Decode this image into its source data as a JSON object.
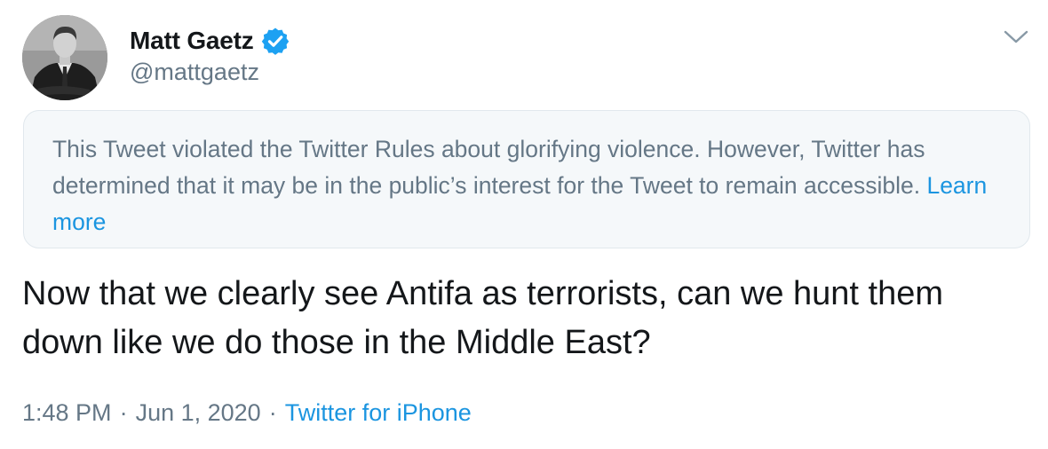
{
  "author": {
    "display_name": "Matt Gaetz",
    "handle": "@mattgaetz",
    "verified_icon": "verified-badge-icon",
    "verified_color": "#1da1f2"
  },
  "menu": {
    "caret_icon": "chevron-down-icon"
  },
  "notice": {
    "text": "This Tweet violated the Twitter Rules about glorifying violence. However, Twitter has determined that it may be in the public’s interest for the Tweet to remain accessible.",
    "link_label": "Learn more"
  },
  "tweet": {
    "text": "Now that we clearly see Antifa as terrorists, can we hunt them down like we do those in the Middle East?"
  },
  "meta": {
    "time": "1:48 PM",
    "separator": "·",
    "date": "Jun 1, 2020",
    "source": "Twitter for iPhone"
  },
  "colors": {
    "link": "#1b95e0",
    "secondary_text": "#657786",
    "primary_text": "#14171a",
    "notice_background": "#f5f8fa"
  }
}
